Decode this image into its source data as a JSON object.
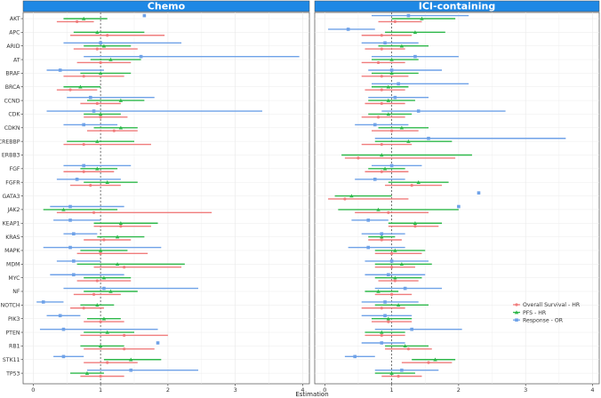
{
  "chart_data": {
    "type": "forest",
    "xlabel": "Estimation",
    "xticks": [
      0,
      1,
      2,
      3,
      4
    ],
    "xlim": [
      -0.15,
      4.1
    ],
    "reference_line": 1,
    "genes": [
      "AKT",
      "APC",
      "ARID",
      "AT",
      "BRAF",
      "BRCA",
      "CCND",
      "CDK",
      "CDKN",
      "CREBBP",
      "ERBB3",
      "FGF",
      "FGFR",
      "GATA3",
      "JAK2",
      "KEAP1",
      "KRAS",
      "MAPK",
      "MDM",
      "MYC",
      "NF",
      "NOTCH",
      "PIK3",
      "PTEN",
      "RB1",
      "STK11",
      "TP53"
    ],
    "series_style": [
      {
        "name": "Overall Survival - HR",
        "color": "#F07C7C",
        "shape": "circle",
        "offset": 1
      },
      {
        "name": "PFS - HR",
        "color": "#2EB84A",
        "shape": "triangle",
        "offset": 0
      },
      {
        "name": "Response - OR",
        "color": "#6FA2E8",
        "shape": "square",
        "offset": -1
      }
    ],
    "panels": [
      {
        "title": "Chemo",
        "series": [
          {
            "name": "Overall Survival - HR",
            "points": [
              [
                0.65,
                0.35,
                0.9
              ],
              [
                1.1,
                0.55,
                1.95
              ],
              [
                0.95,
                0.6,
                1.55
              ],
              [
                1.0,
                0.65,
                1.45
              ],
              [
                0.75,
                0.45,
                1.35
              ],
              [
                0.55,
                0.35,
                0.95
              ],
              [
                0.95,
                0.7,
                1.3
              ],
              [
                1.0,
                0.75,
                1.4
              ],
              [
                1.2,
                0.8,
                1.55
              ],
              [
                0.75,
                0.45,
                1.75
              ],
              [
                null,
                null,
                null
              ],
              [
                0.75,
                0.45,
                1.2
              ],
              [
                0.85,
                0.55,
                1.3
              ],
              [
                null,
                null,
                null
              ],
              [
                0.9,
                0.35,
                2.65
              ],
              [
                1.3,
                0.9,
                1.75
              ],
              [
                1.05,
                0.75,
                1.45
              ],
              [
                1.0,
                0.65,
                1.7
              ],
              [
                1.35,
                0.9,
                2.2
              ],
              [
                0.95,
                0.65,
                1.45
              ],
              [
                0.9,
                0.6,
                1.3
              ],
              [
                0.75,
                0.55,
                1.05
              ],
              [
                1.0,
                0.75,
                1.35
              ],
              [
                1.35,
                0.7,
                2.0
              ],
              [
                1.35,
                0.75,
                1.8
              ],
              [
                1.1,
                0.75,
                1.55
              ],
              [
                1.0,
                0.7,
                1.35
              ]
            ]
          },
          {
            "name": "PFS - HR",
            "points": [
              [
                0.75,
                0.45,
                1.1
              ],
              [
                0.95,
                0.6,
                1.65
              ],
              [
                1.05,
                0.75,
                1.45
              ],
              [
                1.15,
                0.85,
                1.6
              ],
              [
                1.0,
                0.7,
                1.45
              ],
              [
                0.7,
                0.45,
                1.0
              ],
              [
                1.3,
                0.8,
                1.65
              ],
              [
                1.0,
                0.75,
                1.3
              ],
              [
                1.3,
                0.9,
                1.55
              ],
              [
                0.95,
                0.5,
                1.5
              ],
              [
                null,
                null,
                null
              ],
              [
                0.95,
                0.7,
                1.25
              ],
              [
                1.1,
                0.75,
                1.55
              ],
              [
                null,
                null,
                null
              ],
              [
                0.45,
                0.15,
                1.25
              ],
              [
                1.3,
                0.9,
                1.85
              ],
              [
                1.25,
                0.95,
                1.65
              ],
              [
                1.0,
                0.7,
                1.4
              ],
              [
                1.25,
                0.65,
                2.25
              ],
              [
                1.05,
                0.75,
                1.45
              ],
              [
                1.15,
                0.75,
                1.55
              ],
              [
                0.95,
                0.7,
                1.2
              ],
              [
                1.05,
                0.8,
                1.3
              ],
              [
                1.1,
                0.75,
                1.5
              ],
              [
                1.0,
                0.7,
                1.35
              ],
              [
                1.45,
                1.05,
                1.9
              ],
              [
                0.8,
                0.55,
                1.05
              ]
            ]
          },
          {
            "name": "Response - OR",
            "points": [
              [
                1.65,
                1.65,
                1.65
              ],
              [
                null,
                null,
                null
              ],
              [
                1.0,
                0.45,
                2.2
              ],
              [
                1.6,
                0.75,
                3.95
              ],
              [
                0.4,
                0.2,
                1.05
              ],
              [
                null,
                null,
                null
              ],
              [
                0.85,
                0.5,
                1.8
              ],
              [
                0.9,
                0.2,
                3.4
              ],
              [
                0.75,
                0.45,
                1.25
              ],
              [
                null,
                null,
                null
              ],
              [
                null,
                null,
                null
              ],
              [
                0.75,
                0.45,
                1.45
              ],
              [
                0.65,
                0.35,
                1.3
              ],
              [
                null,
                null,
                null
              ],
              [
                0.55,
                0.25,
                1.35
              ],
              [
                0.55,
                0.3,
                1.0
              ],
              [
                0.6,
                0.45,
                0.95
              ],
              [
                0.55,
                0.15,
                1.9
              ],
              [
                0.6,
                0.35,
                1.0
              ],
              [
                0.6,
                0.25,
                1.35
              ],
              [
                1.05,
                0.45,
                2.45
              ],
              [
                0.15,
                0.05,
                0.45
              ],
              [
                0.4,
                0.2,
                0.7
              ],
              [
                0.45,
                0.1,
                1.85
              ],
              [
                1.85,
                1.85,
                1.85
              ],
              [
                0.45,
                0.3,
                0.75
              ],
              [
                1.45,
                0.8,
                2.45
              ]
            ]
          }
        ]
      },
      {
        "title": "ICI-containing",
        "series": [
          {
            "name": "Overall Survival - HR",
            "points": [
              [
                1.05,
                0.8,
                1.45
              ],
              [
                0.85,
                0.55,
                1.3
              ],
              [
                0.85,
                0.6,
                1.2
              ],
              [
                0.8,
                0.55,
                1.2
              ],
              [
                0.85,
                0.55,
                1.25
              ],
              [
                0.85,
                0.6,
                1.2
              ],
              [
                0.85,
                0.6,
                1.2
              ],
              [
                0.8,
                0.55,
                1.2
              ],
              [
                1.0,
                0.7,
                1.4
              ],
              [
                0.85,
                0.55,
                1.3
              ],
              [
                0.5,
                0.3,
                1.95
              ],
              [
                0.85,
                0.6,
                1.25
              ],
              [
                1.3,
                0.9,
                1.75
              ],
              [
                0.3,
                0.05,
                1.25
              ],
              [
                0.95,
                0.45,
                1.55
              ],
              [
                1.35,
                0.95,
                1.7
              ],
              [
                0.85,
                0.65,
                1.15
              ],
              [
                1.0,
                0.75,
                1.45
              ],
              [
                1.0,
                0.75,
                1.35
              ],
              [
                1.05,
                0.8,
                1.4
              ],
              [
                1.0,
                0.75,
                1.3
              ],
              [
                0.85,
                0.55,
                1.2
              ],
              [
                0.95,
                0.7,
                1.3
              ],
              [
                0.85,
                0.6,
                1.2
              ],
              [
                1.25,
                0.9,
                1.6
              ],
              [
                1.55,
                1.15,
                1.9
              ],
              [
                1.1,
                0.85,
                1.45
              ]
            ]
          },
          {
            "name": "PFS - HR",
            "points": [
              [
                1.45,
                1.0,
                1.95
              ],
              [
                1.35,
                0.9,
                1.8
              ],
              [
                1.15,
                0.8,
                1.55
              ],
              [
                1.0,
                0.7,
                1.4
              ],
              [
                1.0,
                0.7,
                1.4
              ],
              [
                0.95,
                0.7,
                1.25
              ],
              [
                0.95,
                0.65,
                1.35
              ],
              [
                0.95,
                0.65,
                1.3
              ],
              [
                1.15,
                0.8,
                1.55
              ],
              [
                1.25,
                0.75,
                1.9
              ],
              [
                0.85,
                0.25,
                2.2
              ],
              [
                0.9,
                0.65,
                1.2
              ],
              [
                1.4,
                0.95,
                1.85
              ],
              [
                0.4,
                0.15,
                1.0
              ],
              [
                0.8,
                0.2,
                2.0
              ],
              [
                1.35,
                0.95,
                1.75
              ],
              [
                0.85,
                0.65,
                1.05
              ],
              [
                1.05,
                0.75,
                1.5
              ],
              [
                1.15,
                0.75,
                1.6
              ],
              [
                1.05,
                0.75,
                1.45
              ],
              [
                0.8,
                0.6,
                1.1
              ],
              [
                1.1,
                0.75,
                1.55
              ],
              [
                0.95,
                0.7,
                1.3
              ],
              [
                0.85,
                0.6,
                1.2
              ],
              [
                1.2,
                0.9,
                1.55
              ],
              [
                1.65,
                1.3,
                1.95
              ],
              [
                1.0,
                0.75,
                1.35
              ]
            ]
          },
          {
            "name": "Response - OR",
            "points": [
              [
                1.25,
                0.7,
                2.15
              ],
              [
                0.35,
                0.05,
                0.75
              ],
              [
                0.9,
                0.55,
                1.4
              ],
              [
                1.35,
                0.7,
                2.0
              ],
              [
                1.0,
                0.65,
                1.75
              ],
              [
                1.1,
                0.7,
                2.15
              ],
              [
                1.05,
                0.65,
                1.55
              ],
              [
                1.4,
                0.85,
                2.7
              ],
              [
                0.75,
                0.45,
                1.25
              ],
              [
                1.55,
                0.75,
                3.6
              ],
              [
                null,
                null,
                null
              ],
              [
                1.0,
                0.7,
                1.45
              ],
              [
                0.75,
                0.45,
                1.2
              ],
              [
                2.3,
                2.3,
                2.3
              ],
              [
                2.0,
                2.0,
                2.0
              ],
              [
                0.65,
                0.4,
                0.95
              ],
              [
                0.85,
                0.55,
                1.2
              ],
              [
                0.65,
                0.35,
                1.2
              ],
              [
                1.0,
                0.6,
                1.55
              ],
              [
                0.95,
                0.6,
                1.5
              ],
              [
                1.2,
                0.75,
                1.75
              ],
              [
                0.9,
                0.55,
                1.4
              ],
              [
                0.9,
                0.55,
                1.3
              ],
              [
                1.3,
                0.75,
                2.05
              ],
              [
                0.85,
                0.55,
                1.2
              ],
              [
                0.45,
                0.3,
                0.75
              ],
              [
                1.15,
                0.75,
                1.7
              ]
            ]
          }
        ]
      }
    ]
  }
}
